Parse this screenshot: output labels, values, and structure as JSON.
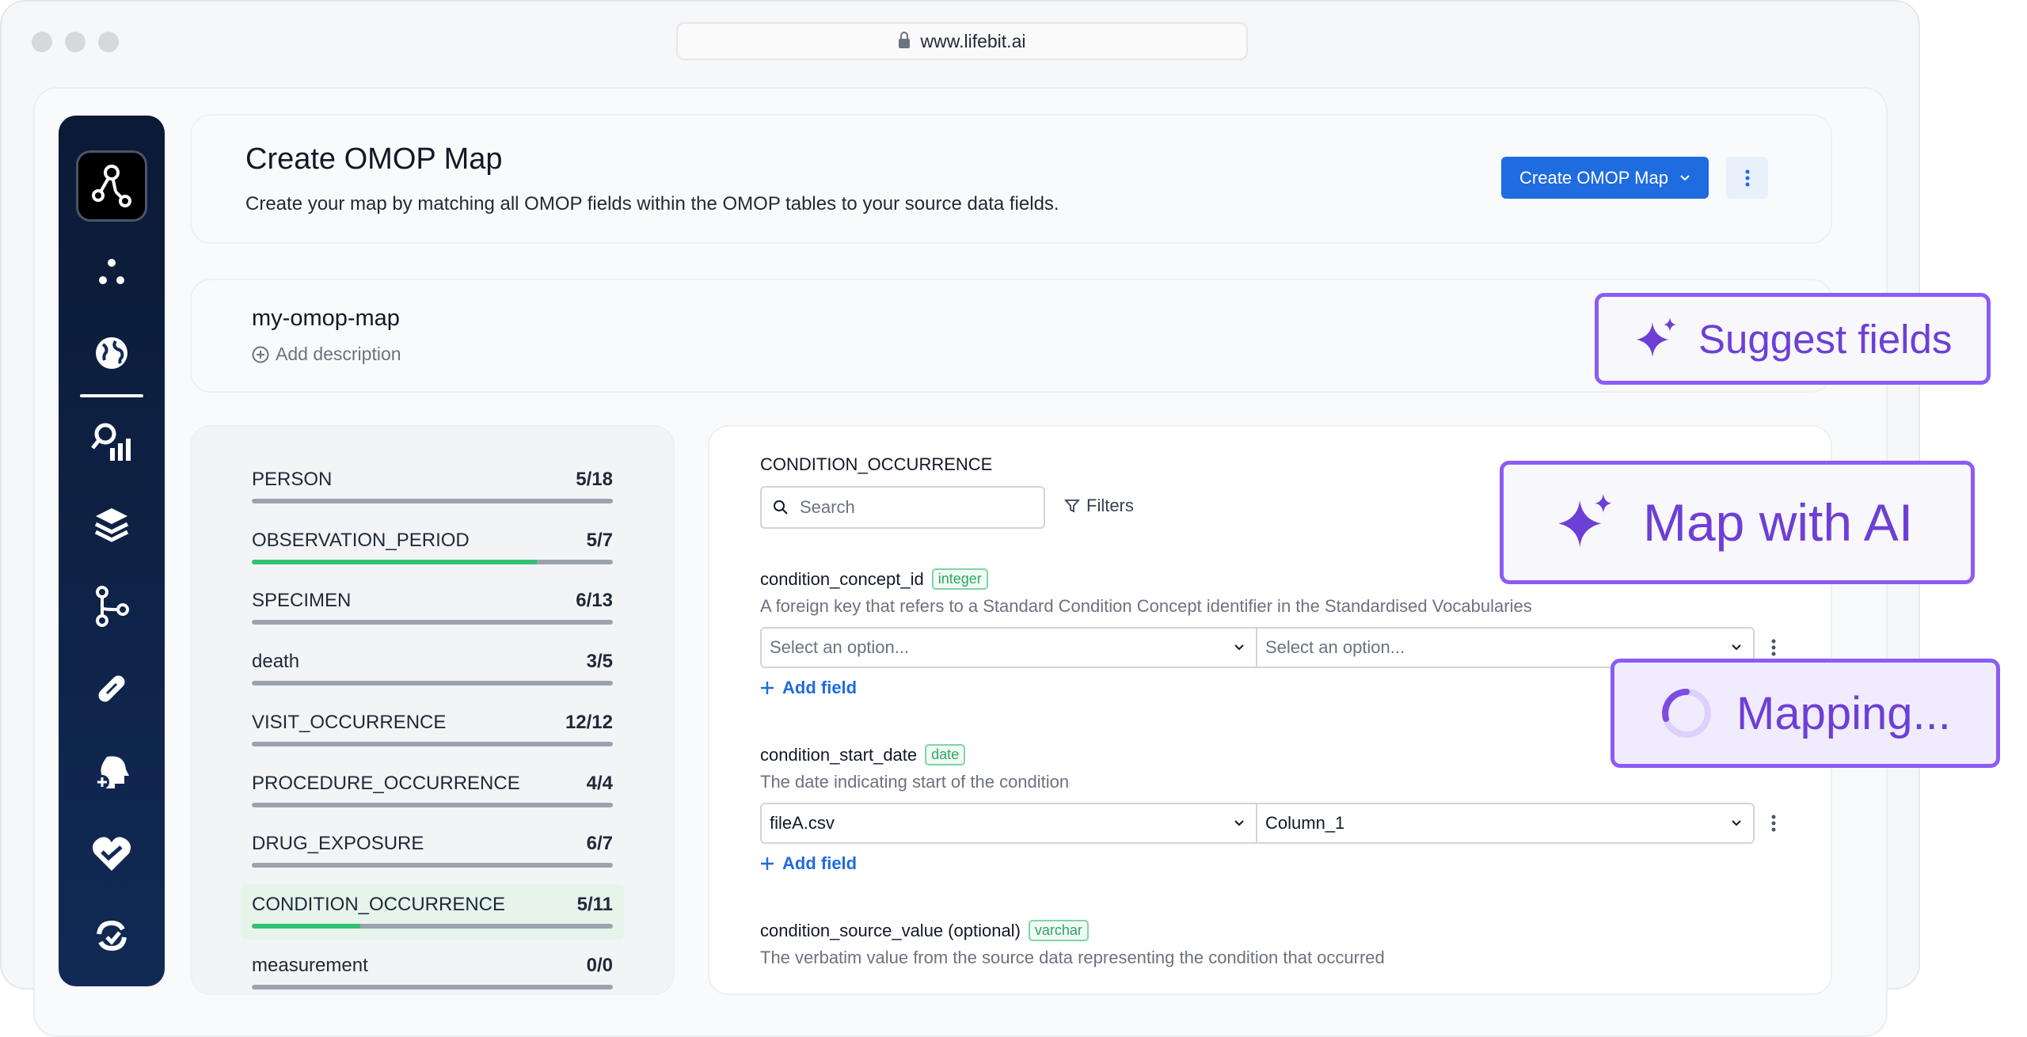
{
  "browser": {
    "url": "www.lifebit.ai"
  },
  "header": {
    "title": "Create OMOP Map",
    "description": "Create your map by matching all OMOP fields within the OMOP tables to your source data fields.",
    "primary_button": "Create OMOP Map"
  },
  "map": {
    "name": "my-omop-map",
    "add_description": "Add description"
  },
  "tables": [
    {
      "name": "PERSON",
      "count": "5/18",
      "progress": 0.0
    },
    {
      "name": "OBSERVATION_PERIOD",
      "count": "5/7",
      "progress": 0.79
    },
    {
      "name": "SPECIMEN",
      "count": "6/13",
      "progress": 0.0
    },
    {
      "name": "death",
      "count": "3/5",
      "progress": 0.0
    },
    {
      "name": "VISIT_OCCURRENCE",
      "count": "12/12",
      "progress": 0.0
    },
    {
      "name": "PROCEDURE_OCCURRENCE",
      "count": "4/4",
      "progress": 0.0
    },
    {
      "name": "DRUG_EXPOSURE",
      "count": "6/7",
      "progress": 0.0
    },
    {
      "name": "CONDITION_OCCURRENCE",
      "count": "5/11",
      "progress": 0.3
    },
    {
      "name": "measurement",
      "count": "0/0",
      "progress": 0.0
    }
  ],
  "detail": {
    "title": "CONDITION_OCCURRENCE",
    "search_placeholder": "Search",
    "filters_label": "Filters",
    "add_field_label": "Add field",
    "fields": [
      {
        "name": "condition_concept_id",
        "optional": "",
        "type": "integer",
        "description": "A foreign key that refers to a Standard Condition Concept identifier in the Standardised Vocabularies",
        "source_file": "Select an option...",
        "source_column": "Select an option..."
      },
      {
        "name": "condition_start_date",
        "optional": "",
        "type": "date",
        "description": "The date indicating start of the condition",
        "source_file": "fileA.csv",
        "source_column": "Column_1"
      },
      {
        "name": "condition_source_value",
        "optional": "(optional)",
        "type": "varchar",
        "description": "The verbatim value from the source data representing the condition that occurred"
      }
    ]
  },
  "callouts": {
    "suggest": "Suggest fields",
    "map_ai": "Map with AI",
    "mapping": "Mapping..."
  },
  "colors": {
    "accent": "#1f6be0",
    "ai_purple": "#8b5cf6",
    "progress_green": "#34c072",
    "sidebar": "#0b1a36"
  }
}
